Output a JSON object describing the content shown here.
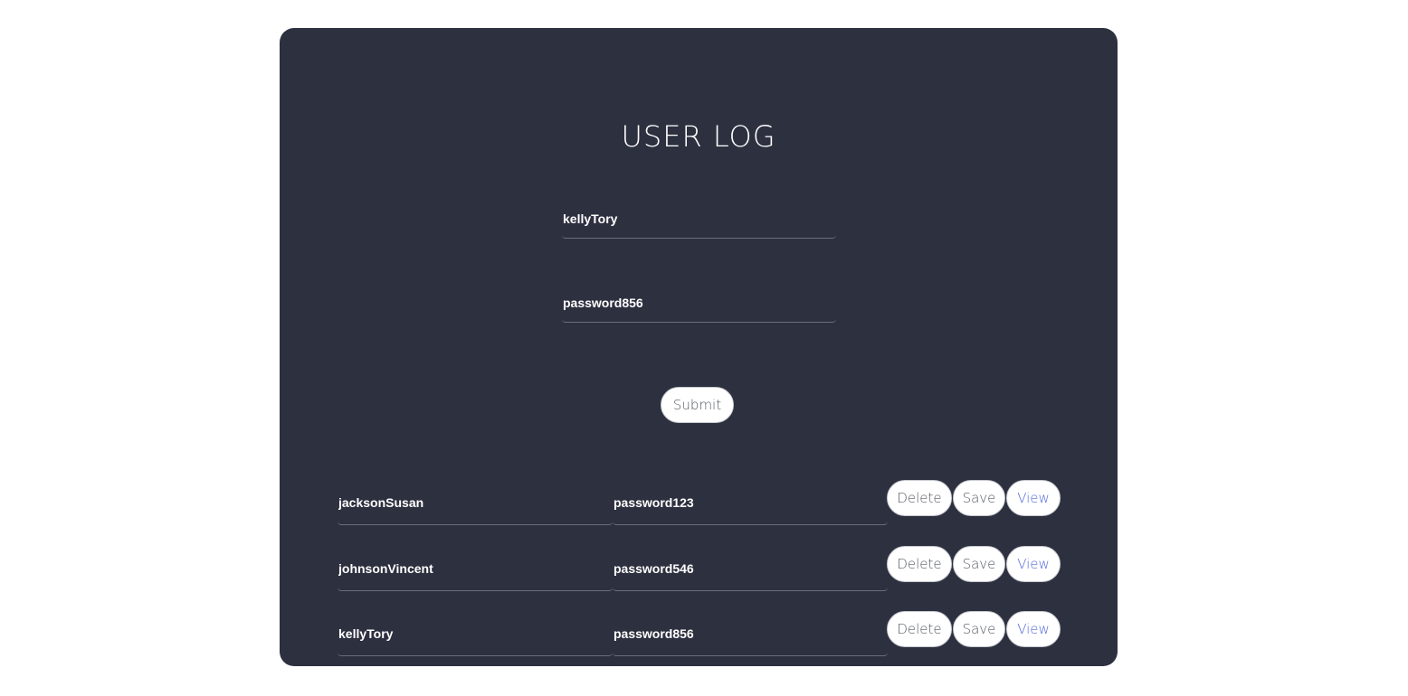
{
  "title": "USER LOG",
  "form": {
    "username": "kellyTory",
    "password": "password856",
    "submit_label": "Submit"
  },
  "entries": [
    {
      "username": "jacksonSusan",
      "password": "password123"
    },
    {
      "username": "johnsonVincent",
      "password": "password546"
    },
    {
      "username": "kellyTory",
      "password": "password856"
    }
  ],
  "actions": {
    "delete_label": "Delete",
    "save_label": "Save",
    "view_label": "View"
  },
  "colors": {
    "card_background": "#2d303f",
    "page_background": "#ffffff",
    "view_link": "#5067d6"
  }
}
